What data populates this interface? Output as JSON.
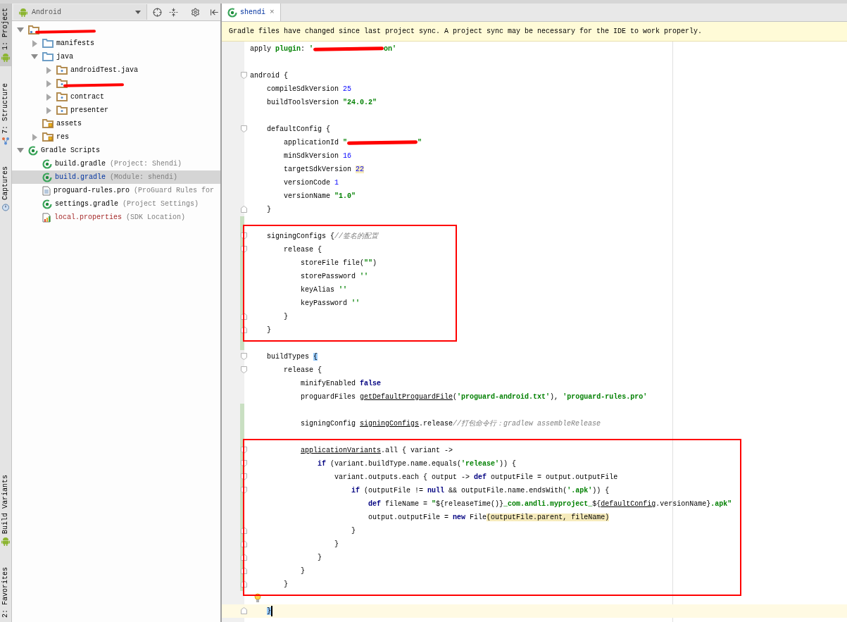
{
  "left_toolbar": {
    "top": [
      {
        "label": "1: Project",
        "kind": "android",
        "selected": true
      },
      {
        "label": "7: Structure",
        "kind": "structure",
        "selected": false
      },
      {
        "label": "Captures",
        "kind": "captures",
        "selected": false
      }
    ],
    "bottom": [
      {
        "label": "Build Variants",
        "kind": "android",
        "selected": false
      },
      {
        "label": "2: Favorites",
        "kind": "favorites",
        "selected": false
      }
    ]
  },
  "project_panel": {
    "view": "Android",
    "tree": [
      {
        "kind": "module",
        "expanded": true,
        "selected": false,
        "children": [
          {
            "kind": "folder",
            "label": "manifests",
            "expanded": false,
            "selected": false,
            "modified": false,
            "unversioned": false
          },
          {
            "kind": "folder",
            "label": "java",
            "expanded": true,
            "selected": false,
            "modified": false,
            "unversioned": false,
            "children": [
              {
                "kind": "package",
                "label": "androidTest.java",
                "expanded": false,
                "selected": false,
                "modified": false,
                "unversioned": false
              },
              {
                "kind": "package",
                "expanded": false,
                "selected": false
              },
              {
                "kind": "package",
                "label": "contract",
                "expanded": false,
                "selected": false,
                "modified": false,
                "unversioned": false
              },
              {
                "kind": "package",
                "label": "presenter",
                "expanded": false,
                "selected": false,
                "modified": false,
                "unversioned": false
              }
            ]
          },
          {
            "kind": "resources",
            "label": "assets",
            "selected": false,
            "modified": false,
            "unversioned": false
          },
          {
            "kind": "resources",
            "label": "res",
            "expanded": false,
            "selected": false,
            "modified": false,
            "unversioned": false
          }
        ]
      },
      {
        "kind": "gradle",
        "label": "Gradle Scripts",
        "expanded": true,
        "selected": false,
        "modified": false,
        "unversioned": false,
        "children": [
          {
            "kind": "gradle",
            "label": "build.gradle",
            "hint": "(Project: Shendi)",
            "selected": false,
            "modified": false,
            "unversioned": false
          },
          {
            "kind": "gradle",
            "label": "build.gradle",
            "hint": "(Module: shendi)",
            "selected": true,
            "modified": true,
            "unversioned": false
          },
          {
            "kind": "text-file",
            "label": "proguard-rules.pro",
            "hint": "(ProGuard Rules for",
            "selected": false,
            "modified": false,
            "unversioned": false
          },
          {
            "kind": "gradle",
            "label": "settings.gradle",
            "hint": "(Project Settings)",
            "selected": false,
            "modified": false,
            "unversioned": false
          },
          {
            "kind": "properties-file",
            "label": "local.properties",
            "hint": "(SDK Location)",
            "selected": false,
            "modified": false,
            "unversioned": true
          }
        ]
      }
    ]
  },
  "editor": {
    "tabs": [
      {
        "label": "shendi",
        "selected": true,
        "close": "×"
      }
    ],
    "notification": "Gradle files have changed since last project sync. A project sync may be necessary for the IDE to work properly.",
    "blocks": [
      {
        "boxed": false,
        "lines": [
          {
            "tokens": [
              {
                "kind": "plain",
                "text": "apply "
              },
              {
                "kind": "named-arg",
                "text": "plugin"
              },
              {
                "kind": "plain",
                "text": ": "
              },
              {
                "kind": "string",
                "text": "'"
              },
              {
                "kind": "redaction"
              },
              {
                "kind": "string",
                "text": "on'"
              }
            ],
            "fold_start": false,
            "fold_end": false,
            "changed": false,
            "current": false,
            "bulb": false
          },
          {
            "fold_start": false,
            "fold_end": false,
            "changed": false,
            "current": false,
            "bulb": false
          },
          {
            "tokens": [
              {
                "kind": "plain",
                "text": "android {"
              }
            ],
            "fold_start": true,
            "fold_end": false,
            "changed": false,
            "current": false,
            "bulb": false
          },
          {
            "tokens": [
              {
                "kind": "plain",
                "text": "    compileSdkVersion "
              },
              {
                "kind": "number",
                "text": "25"
              }
            ],
            "fold_start": false,
            "fold_end": false,
            "changed": false,
            "current": false,
            "bulb": false
          },
          {
            "tokens": [
              {
                "kind": "plain",
                "text": "    buildToolsVersion "
              },
              {
                "kind": "string",
                "text": "\"24.0.2\""
              }
            ],
            "fold_start": false,
            "fold_end": false,
            "changed": false,
            "current": false,
            "bulb": false
          },
          {
            "fold_start": false,
            "fold_end": false,
            "changed": false,
            "current": false,
            "bulb": false
          },
          {
            "tokens": [
              {
                "kind": "plain",
                "text": "    defaultConfig {"
              }
            ],
            "fold_start": true,
            "fold_end": false,
            "changed": false,
            "current": false,
            "bulb": false
          },
          {
            "tokens": [
              {
                "kind": "plain",
                "text": "        applicationId "
              },
              {
                "kind": "string",
                "text": "\""
              },
              {
                "kind": "redaction"
              },
              {
                "kind": "string",
                "text": "\""
              }
            ],
            "fold_start": false,
            "fold_end": false,
            "changed": false,
            "current": false,
            "bulb": false
          },
          {
            "tokens": [
              {
                "kind": "plain",
                "text": "        minSdkVersion "
              },
              {
                "kind": "number",
                "text": "16"
              }
            ],
            "fold_start": false,
            "fold_end": false,
            "changed": false,
            "current": false,
            "bulb": false
          },
          {
            "tokens": [
              {
                "kind": "plain",
                "text": "        targetSdkVersion "
              },
              {
                "kind": "number-warning",
                "text": "22"
              }
            ],
            "fold_start": false,
            "fold_end": false,
            "changed": false,
            "current": false,
            "bulb": false
          },
          {
            "tokens": [
              {
                "kind": "plain",
                "text": "        versionCode "
              },
              {
                "kind": "number",
                "text": "1"
              }
            ],
            "fold_start": false,
            "fold_end": false,
            "changed": false,
            "current": false,
            "bulb": false
          },
          {
            "tokens": [
              {
                "kind": "plain",
                "text": "        versionName "
              },
              {
                "kind": "string",
                "text": "\"1.0\""
              }
            ],
            "fold_start": false,
            "fold_end": false,
            "changed": false,
            "current": false,
            "bulb": false
          },
          {
            "tokens": [
              {
                "kind": "plain",
                "text": "    }"
              }
            ],
            "fold_start": false,
            "fold_end": true,
            "changed": false,
            "current": false,
            "bulb": false
          },
          {
            "fold_start": false,
            "fold_end": false,
            "changed": true,
            "current": false,
            "bulb": false
          }
        ]
      },
      {
        "boxed": true,
        "lines": [
          {
            "tokens": [
              {
                "kind": "plain",
                "text": "    signingConfigs {"
              },
              {
                "kind": "comment",
                "text": "//签名的配置"
              }
            ],
            "fold_start": true,
            "fold_end": false,
            "changed": true,
            "current": false,
            "bulb": false
          },
          {
            "tokens": [
              {
                "kind": "plain",
                "text": "        release {"
              }
            ],
            "fold_start": true,
            "fold_end": false,
            "changed": true,
            "current": false,
            "bulb": false
          },
          {
            "tokens": [
              {
                "kind": "plain",
                "text": "            storeFile file("
              },
              {
                "kind": "string",
                "text": "\"\""
              },
              {
                "kind": "plain",
                "text": ")"
              }
            ],
            "fold_start": false,
            "fold_end": false,
            "changed": true,
            "current": false,
            "bulb": false
          },
          {
            "tokens": [
              {
                "kind": "plain",
                "text": "            storePassword "
              },
              {
                "kind": "string",
                "text": "''"
              }
            ],
            "fold_start": false,
            "fold_end": false,
            "changed": true,
            "current": false,
            "bulb": false
          },
          {
            "tokens": [
              {
                "kind": "plain",
                "text": "            keyAlias "
              },
              {
                "kind": "string",
                "text": "''"
              }
            ],
            "fold_start": false,
            "fold_end": false,
            "changed": true,
            "current": false,
            "bulb": false
          },
          {
            "tokens": [
              {
                "kind": "plain",
                "text": "            keyPassword "
              },
              {
                "kind": "string",
                "text": "''"
              }
            ],
            "fold_start": false,
            "fold_end": false,
            "changed": true,
            "current": false,
            "bulb": false
          },
          {
            "tokens": [
              {
                "kind": "plain",
                "text": "        }"
              }
            ],
            "fold_start": false,
            "fold_end": true,
            "changed": true,
            "current": false,
            "bulb": false
          },
          {
            "tokens": [
              {
                "kind": "plain",
                "text": "    }"
              }
            ],
            "fold_start": false,
            "fold_end": true,
            "changed": true,
            "current": false,
            "bulb": false
          }
        ]
      },
      {
        "boxed": false,
        "lines": [
          {
            "fold_start": false,
            "fold_end": false,
            "changed": true,
            "current": false,
            "bulb": false
          },
          {
            "tokens": [
              {
                "kind": "plain",
                "text": "    buildTypes "
              },
              {
                "kind": "brace-match",
                "text": "{"
              }
            ],
            "fold_start": true,
            "fold_end": false,
            "changed": false,
            "current": false,
            "bulb": false
          },
          {
            "tokens": [
              {
                "kind": "plain",
                "text": "        release {"
              }
            ],
            "fold_start": true,
            "fold_end": false,
            "changed": false,
            "current": false,
            "bulb": false
          },
          {
            "tokens": [
              {
                "kind": "plain",
                "text": "            minifyEnabled "
              },
              {
                "kind": "keyword",
                "text": "false"
              }
            ],
            "fold_start": false,
            "fold_end": false,
            "changed": false,
            "current": false,
            "bulb": false
          },
          {
            "tokens": [
              {
                "kind": "plain",
                "text": "            proguardFiles "
              },
              {
                "kind": "reference",
                "text": "getDefaultProguardFile"
              },
              {
                "kind": "plain",
                "text": "("
              },
              {
                "kind": "string",
                "text": "'proguard-android.txt'"
              },
              {
                "kind": "plain",
                "text": "), "
              },
              {
                "kind": "string",
                "text": "'proguard-rules.pro'"
              }
            ],
            "fold_start": false,
            "fold_end": false,
            "changed": false,
            "current": false,
            "bulb": false
          },
          {
            "fold_start": false,
            "fold_end": false,
            "changed": true,
            "current": false,
            "bulb": false
          },
          {
            "tokens": [
              {
                "kind": "plain",
                "text": "            signingConfig "
              },
              {
                "kind": "reference",
                "text": "signingConfigs"
              },
              {
                "kind": "plain",
                "text": ".release"
              },
              {
                "kind": "comment",
                "text": "//打包命令行：gradlew assembleRelease"
              }
            ],
            "fold_start": false,
            "fold_end": false,
            "changed": true,
            "current": false,
            "bulb": false
          },
          {
            "fold_start": false,
            "fold_end": false,
            "changed": true,
            "current": false,
            "bulb": false
          }
        ]
      },
      {
        "boxed": true,
        "lines": [
          {
            "tokens": [
              {
                "kind": "reference",
                "text": "            applicationVariants"
              },
              {
                "kind": "plain",
                "text": ".all { variant ->"
              }
            ],
            "fold_start": true,
            "fold_end": false,
            "changed": true,
            "current": false,
            "bulb": false
          },
          {
            "tokens": [
              {
                "kind": "keyword",
                "text": "                if"
              },
              {
                "kind": "plain",
                "text": " (variant.buildType.name.equals("
              },
              {
                "kind": "string",
                "text": "'release'"
              },
              {
                "kind": "plain",
                "text": ")) {"
              }
            ],
            "fold_start": true,
            "fold_end": false,
            "changed": true,
            "current": false,
            "bulb": false
          },
          {
            "tokens": [
              {
                "kind": "plain",
                "text": "                    variant.outputs.each { output -> "
              },
              {
                "kind": "keyword",
                "text": "def"
              },
              {
                "kind": "plain",
                "text": " outputFile = output.outputFile"
              }
            ],
            "fold_start": true,
            "fold_end": false,
            "changed": true,
            "current": false,
            "bulb": false
          },
          {
            "tokens": [
              {
                "kind": "keyword",
                "text": "                        if"
              },
              {
                "kind": "plain",
                "text": " (outputFile != "
              },
              {
                "kind": "keyword",
                "text": "null"
              },
              {
                "kind": "plain",
                "text": " && outputFile.name.endsWith("
              },
              {
                "kind": "string",
                "text": "'.apk'"
              },
              {
                "kind": "plain",
                "text": ")) {"
              }
            ],
            "fold_start": true,
            "fold_end": false,
            "changed": true,
            "current": false,
            "bulb": false
          },
          {
            "tokens": [
              {
                "kind": "keyword",
                "text": "                            def"
              },
              {
                "kind": "plain",
                "text": " fileName = "
              },
              {
                "kind": "string",
                "text": "\""
              },
              {
                "kind": "plain",
                "text": "${releaseTime()}"
              },
              {
                "kind": "string",
                "text": "_com.andli.myproject_"
              },
              {
                "kind": "plain",
                "text": "${"
              },
              {
                "kind": "reference",
                "text": "defaultConfig"
              },
              {
                "kind": "plain",
                "text": ".versionName}"
              },
              {
                "kind": "string",
                "text": ".apk\""
              }
            ],
            "fold_start": false,
            "fold_end": false,
            "changed": true,
            "current": false,
            "bulb": false
          },
          {
            "tokens": [
              {
                "kind": "plain",
                "text": "                            output.outputFile = "
              },
              {
                "kind": "keyword",
                "text": "new"
              },
              {
                "kind": "plain",
                "text": " File"
              },
              {
                "kind": "param-highlight",
                "text": "(outputFile.parent, fileName)"
              }
            ],
            "fold_start": false,
            "fold_end": false,
            "changed": true,
            "current": false,
            "bulb": false
          },
          {
            "tokens": [
              {
                "kind": "plain",
                "text": "                        }"
              }
            ],
            "fold_start": false,
            "fold_end": true,
            "changed": true,
            "current": false,
            "bulb": false
          },
          {
            "tokens": [
              {
                "kind": "plain",
                "text": "                    }"
              }
            ],
            "fold_start": false,
            "fold_end": true,
            "changed": true,
            "current": false,
            "bulb": false
          },
          {
            "tokens": [
              {
                "kind": "plain",
                "text": "                }"
              }
            ],
            "fold_start": false,
            "fold_end": true,
            "changed": true,
            "current": false,
            "bulb": false
          },
          {
            "tokens": [
              {
                "kind": "plain",
                "text": "            }"
              }
            ],
            "fold_start": false,
            "fold_end": true,
            "changed": true,
            "current": false,
            "bulb": false
          },
          {
            "tokens": [
              {
                "kind": "plain",
                "text": "        }"
              }
            ],
            "fold_start": false,
            "fold_end": true,
            "changed": true,
            "current": false,
            "bulb": false
          }
        ]
      },
      {
        "boxed": false,
        "lines": [
          {
            "fold_start": false,
            "fold_end": false,
            "changed": false,
            "current": false,
            "bulb": true
          },
          {
            "tokens": [
              {
                "kind": "brace-match",
                "text": "    }"
              }
            ],
            "fold_start": false,
            "fold_end": true,
            "changed": false,
            "current": true,
            "bulb": false
          }
        ]
      }
    ]
  }
}
